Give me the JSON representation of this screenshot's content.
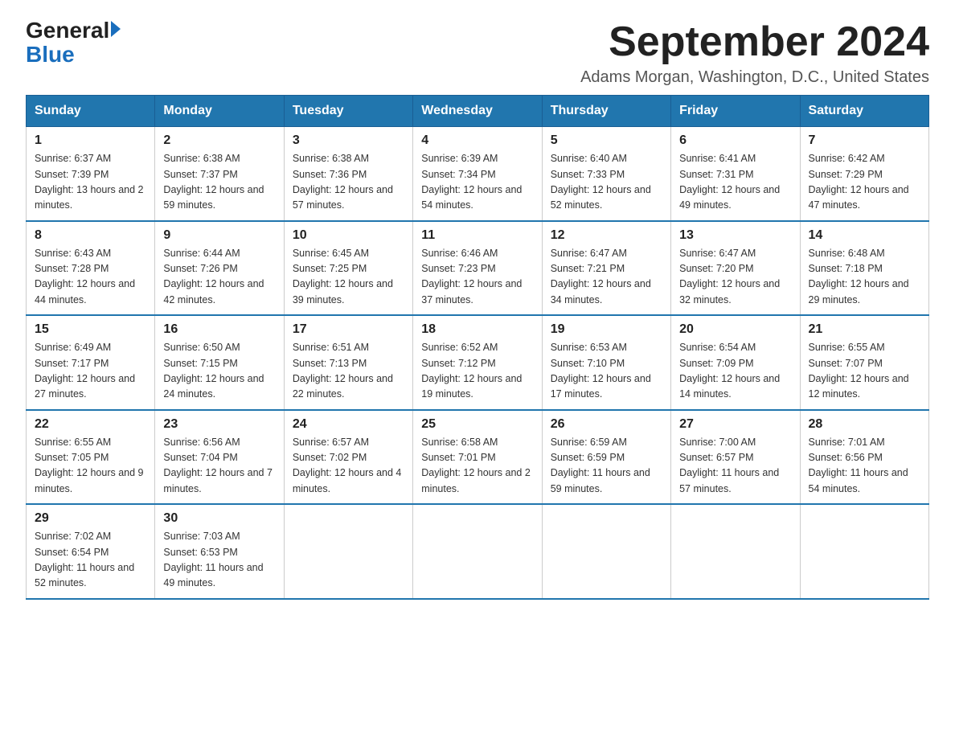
{
  "header": {
    "logo_general": "General",
    "logo_blue": "Blue",
    "title": "September 2024",
    "subtitle": "Adams Morgan, Washington, D.C., United States"
  },
  "weekdays": [
    "Sunday",
    "Monday",
    "Tuesday",
    "Wednesday",
    "Thursday",
    "Friday",
    "Saturday"
  ],
  "weeks": [
    [
      {
        "day": "1",
        "sunrise": "6:37 AM",
        "sunset": "7:39 PM",
        "daylight": "13 hours and 2 minutes."
      },
      {
        "day": "2",
        "sunrise": "6:38 AM",
        "sunset": "7:37 PM",
        "daylight": "12 hours and 59 minutes."
      },
      {
        "day": "3",
        "sunrise": "6:38 AM",
        "sunset": "7:36 PM",
        "daylight": "12 hours and 57 minutes."
      },
      {
        "day": "4",
        "sunrise": "6:39 AM",
        "sunset": "7:34 PM",
        "daylight": "12 hours and 54 minutes."
      },
      {
        "day": "5",
        "sunrise": "6:40 AM",
        "sunset": "7:33 PM",
        "daylight": "12 hours and 52 minutes."
      },
      {
        "day": "6",
        "sunrise": "6:41 AM",
        "sunset": "7:31 PM",
        "daylight": "12 hours and 49 minutes."
      },
      {
        "day": "7",
        "sunrise": "6:42 AM",
        "sunset": "7:29 PM",
        "daylight": "12 hours and 47 minutes."
      }
    ],
    [
      {
        "day": "8",
        "sunrise": "6:43 AM",
        "sunset": "7:28 PM",
        "daylight": "12 hours and 44 minutes."
      },
      {
        "day": "9",
        "sunrise": "6:44 AM",
        "sunset": "7:26 PM",
        "daylight": "12 hours and 42 minutes."
      },
      {
        "day": "10",
        "sunrise": "6:45 AM",
        "sunset": "7:25 PM",
        "daylight": "12 hours and 39 minutes."
      },
      {
        "day": "11",
        "sunrise": "6:46 AM",
        "sunset": "7:23 PM",
        "daylight": "12 hours and 37 minutes."
      },
      {
        "day": "12",
        "sunrise": "6:47 AM",
        "sunset": "7:21 PM",
        "daylight": "12 hours and 34 minutes."
      },
      {
        "day": "13",
        "sunrise": "6:47 AM",
        "sunset": "7:20 PM",
        "daylight": "12 hours and 32 minutes."
      },
      {
        "day": "14",
        "sunrise": "6:48 AM",
        "sunset": "7:18 PM",
        "daylight": "12 hours and 29 minutes."
      }
    ],
    [
      {
        "day": "15",
        "sunrise": "6:49 AM",
        "sunset": "7:17 PM",
        "daylight": "12 hours and 27 minutes."
      },
      {
        "day": "16",
        "sunrise": "6:50 AM",
        "sunset": "7:15 PM",
        "daylight": "12 hours and 24 minutes."
      },
      {
        "day": "17",
        "sunrise": "6:51 AM",
        "sunset": "7:13 PM",
        "daylight": "12 hours and 22 minutes."
      },
      {
        "day": "18",
        "sunrise": "6:52 AM",
        "sunset": "7:12 PM",
        "daylight": "12 hours and 19 minutes."
      },
      {
        "day": "19",
        "sunrise": "6:53 AM",
        "sunset": "7:10 PM",
        "daylight": "12 hours and 17 minutes."
      },
      {
        "day": "20",
        "sunrise": "6:54 AM",
        "sunset": "7:09 PM",
        "daylight": "12 hours and 14 minutes."
      },
      {
        "day": "21",
        "sunrise": "6:55 AM",
        "sunset": "7:07 PM",
        "daylight": "12 hours and 12 minutes."
      }
    ],
    [
      {
        "day": "22",
        "sunrise": "6:55 AM",
        "sunset": "7:05 PM",
        "daylight": "12 hours and 9 minutes."
      },
      {
        "day": "23",
        "sunrise": "6:56 AM",
        "sunset": "7:04 PM",
        "daylight": "12 hours and 7 minutes."
      },
      {
        "day": "24",
        "sunrise": "6:57 AM",
        "sunset": "7:02 PM",
        "daylight": "12 hours and 4 minutes."
      },
      {
        "day": "25",
        "sunrise": "6:58 AM",
        "sunset": "7:01 PM",
        "daylight": "12 hours and 2 minutes."
      },
      {
        "day": "26",
        "sunrise": "6:59 AM",
        "sunset": "6:59 PM",
        "daylight": "11 hours and 59 minutes."
      },
      {
        "day": "27",
        "sunrise": "7:00 AM",
        "sunset": "6:57 PM",
        "daylight": "11 hours and 57 minutes."
      },
      {
        "day": "28",
        "sunrise": "7:01 AM",
        "sunset": "6:56 PM",
        "daylight": "11 hours and 54 minutes."
      }
    ],
    [
      {
        "day": "29",
        "sunrise": "7:02 AM",
        "sunset": "6:54 PM",
        "daylight": "11 hours and 52 minutes."
      },
      {
        "day": "30",
        "sunrise": "7:03 AM",
        "sunset": "6:53 PM",
        "daylight": "11 hours and 49 minutes."
      },
      null,
      null,
      null,
      null,
      null
    ]
  ]
}
